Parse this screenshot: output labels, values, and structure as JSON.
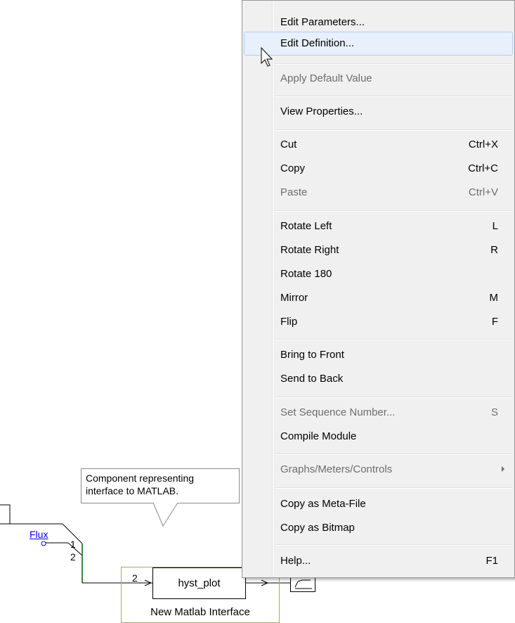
{
  "canvas": {
    "tooltip": {
      "line1": "Component representing",
      "line2": "interface to MATLAB."
    },
    "flux_label": "Flux",
    "port_numbers": [
      "1",
      "2"
    ],
    "block": {
      "input_number": "2",
      "name": "hyst_plot",
      "caption": "New Matlab Interface"
    },
    "wire_color": "#3a8a3a",
    "block_border_color": "#a4a86a"
  },
  "context_menu": {
    "items": [
      {
        "label": "Edit Parameters...",
        "shortcut": "",
        "enabled": true
      },
      {
        "label": "Edit Definition...",
        "shortcut": "",
        "enabled": true,
        "hovered": true
      },
      {
        "label": "Apply Default Value",
        "shortcut": "",
        "enabled": false
      },
      {
        "label": "View Properties...",
        "shortcut": "",
        "enabled": true
      },
      {
        "label": "Cut",
        "shortcut": "Ctrl+X",
        "enabled": true
      },
      {
        "label": "Copy",
        "shortcut": "Ctrl+C",
        "enabled": true
      },
      {
        "label": "Paste",
        "shortcut": "Ctrl+V",
        "enabled": false
      },
      {
        "label": "Rotate Left",
        "shortcut": "L",
        "enabled": true
      },
      {
        "label": "Rotate Right",
        "shortcut": "R",
        "enabled": true
      },
      {
        "label": "Rotate 180",
        "shortcut": "",
        "enabled": true
      },
      {
        "label": "Mirror",
        "shortcut": "M",
        "enabled": true
      },
      {
        "label": "Flip",
        "shortcut": "F",
        "enabled": true
      },
      {
        "label": "Bring to Front",
        "shortcut": "",
        "enabled": true
      },
      {
        "label": "Send to Back",
        "shortcut": "",
        "enabled": true
      },
      {
        "label": "Set Sequence Number...",
        "shortcut": "S",
        "enabled": false
      },
      {
        "label": "Compile Module",
        "shortcut": "",
        "enabled": true
      },
      {
        "label": "Graphs/Meters/Controls",
        "shortcut": "",
        "enabled": false,
        "submenu": true
      },
      {
        "label": "Copy as Meta-File",
        "shortcut": "",
        "enabled": true
      },
      {
        "label": "Copy as Bitmap",
        "shortcut": "",
        "enabled": true
      },
      {
        "label": "Help...",
        "shortcut": "F1",
        "enabled": true
      }
    ]
  }
}
